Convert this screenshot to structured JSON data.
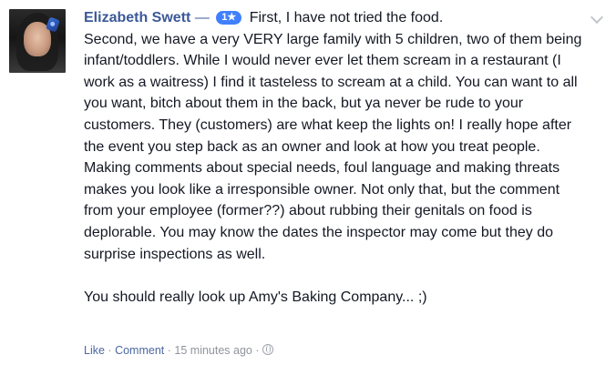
{
  "comment": {
    "author": "Elizabeth Swett",
    "separator": "—",
    "rating_badge": "1★",
    "text": "First, I have not tried the food.\nSecond, we have a very VERY large family with 5 children, two of them being infant/toddlers. While I would never ever let them scream in a restaurant (I work as a waitress) I find it tasteless to scream at a child. You can want to all you want, bitch about them in the back, but ya never be rude to your customers. They (customers) are what keep the lights on! I really hope after the event you step back as an owner and look at how you treat people. Making comments about special needs, foul language and making threats makes you look like a irresponsible owner. Not only that, but the comment from your employee (former??) about rubbing their genitals on food is deplorable. You may know the dates the inspector may come but they do surprise inspections as well.\n\nYou should really look up Amy's Baking Company... ;)",
    "actions": {
      "like": "Like",
      "comment": "Comment",
      "dot": "·",
      "timestamp": "15 minutes ago"
    }
  },
  "colors": {
    "link": "#3b5998",
    "badge": "#4080ff",
    "meta": "#90949c"
  },
  "icons": [
    "globe-icon",
    "chevron-down-icon"
  ]
}
